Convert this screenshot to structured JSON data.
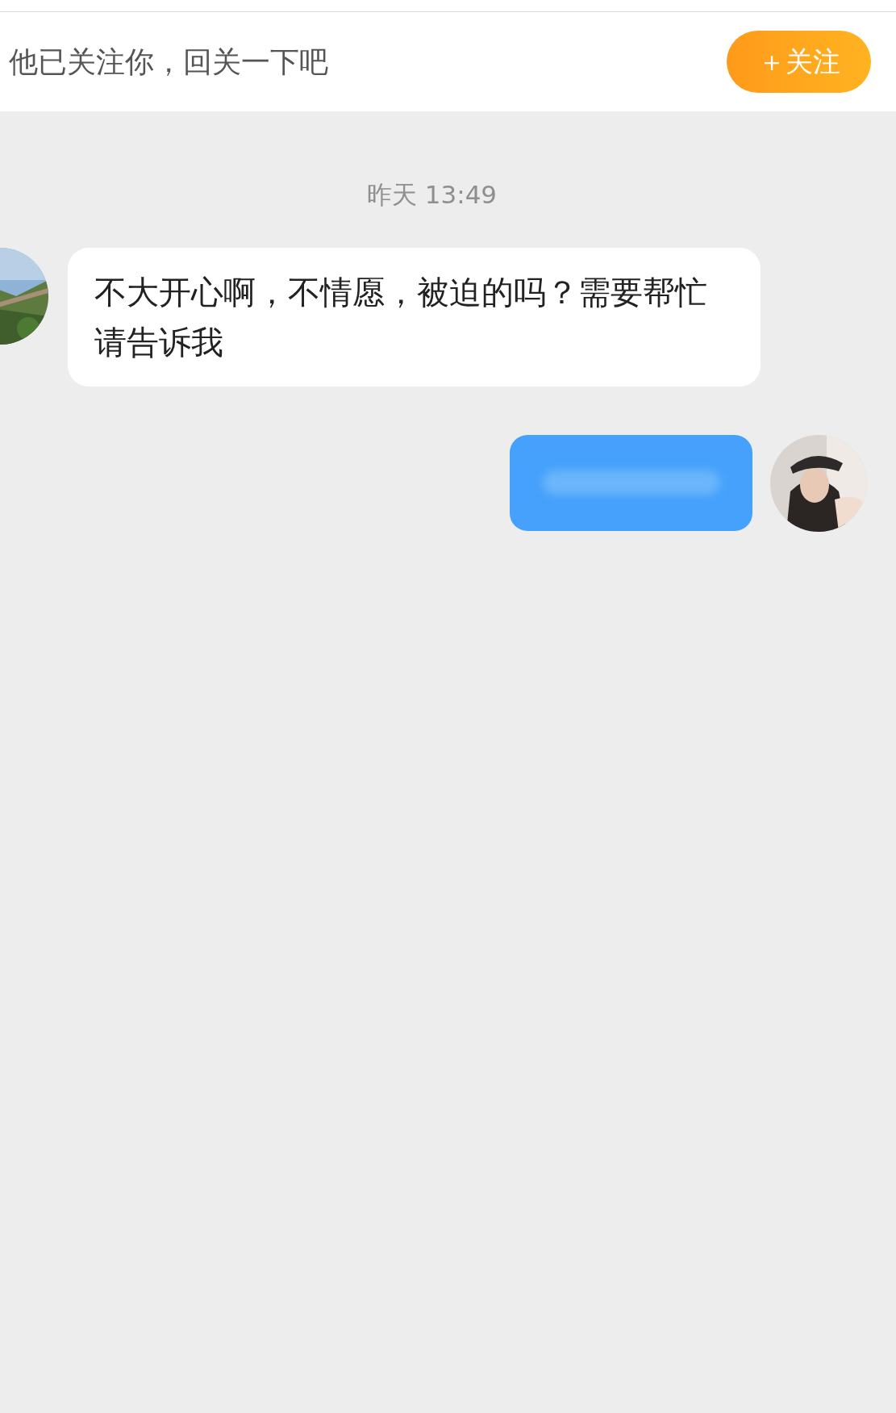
{
  "follow_banner": {
    "text": "他已关注你，回关一下吧",
    "button": "＋关注"
  },
  "timestamp": "昨天 13:49",
  "messages": [
    {
      "kind": "received",
      "text": "不大开心啊，不情愿，被迫的吗？需要帮忙请告诉我"
    },
    {
      "kind": "sent"
    }
  ]
}
